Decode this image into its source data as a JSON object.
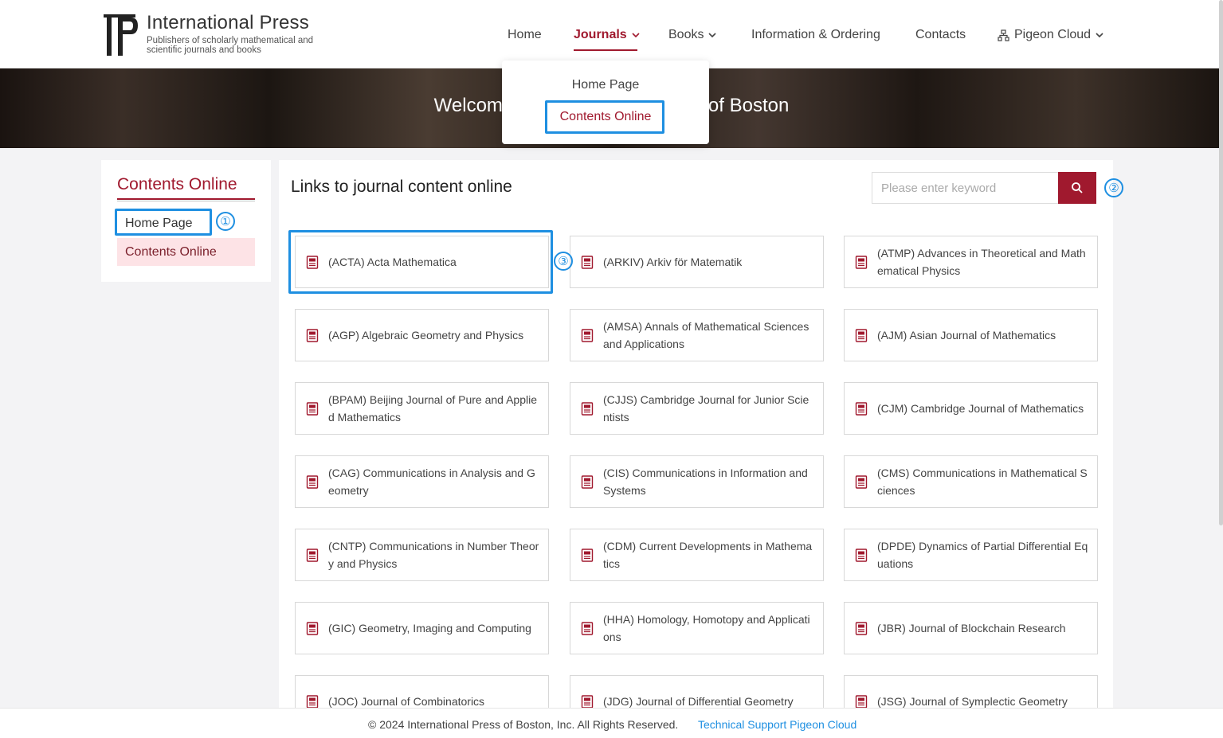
{
  "brand": {
    "title": "International Press",
    "subtitle": "Publishers of scholarly mathematical and scientific journals and books"
  },
  "nav": {
    "items": [
      {
        "label": "Home"
      },
      {
        "label": "Journals"
      },
      {
        "label": "Books"
      },
      {
        "label": "Information & Ordering"
      },
      {
        "label": "Contacts"
      },
      {
        "label": "Pigeon Cloud"
      }
    ]
  },
  "banner": {
    "text_left": "Welcom",
    "text_right": "of Boston"
  },
  "dropdown": {
    "items": [
      {
        "label": "Home Page"
      },
      {
        "label": "Contents Online"
      }
    ]
  },
  "sidebar": {
    "title": "Contents Online",
    "items": [
      {
        "label": "Home Page"
      },
      {
        "label": "Contents Online"
      }
    ]
  },
  "main": {
    "title": "Links to journal content online",
    "search_placeholder": "Please enter keyword",
    "journals": [
      "(ACTA) Acta Mathematica",
      "(ARKIV) Arkiv för Matematik",
      "(ATMP) Advances in Theoretical and Mathematical Physics",
      "(AGP) Algebraic Geometry and Physics",
      "(AMSA) Annals of Mathematical Sciences and Applications",
      "(AJM) Asian Journal of Mathematics",
      "(BPAM) Beijing Journal of Pure and Applied Mathematics",
      "(CJJS) Cambridge Journal for Junior Scientists",
      "(CJM) Cambridge Journal of Mathematics",
      "(CAG) Communications in Analysis and Geometry",
      "(CIS) Communications in Information and Systems",
      "(CMS) Communications in Mathematical Sciences",
      "(CNTP) Communications in Number Theory and Physics",
      "(CDM) Current Developments in Mathematics",
      "(DPDE) Dynamics of Partial Differential Equations",
      "(GIC) Geometry, Imaging and Computing",
      "(HHA) Homology, Homotopy and Applications",
      "(JBR) Journal of Blockchain Research",
      "(JOC) Journal of Combinatorics",
      "(JDG) Journal of Differential Geometry",
      "(JSG) Journal of Symplectic Geometry"
    ]
  },
  "annotations": [
    "①",
    "②",
    "③"
  ],
  "footer": {
    "copyright": "© 2024 International Press of Boston, Inc. All Rights Reserved.",
    "tech_support": "Technical Support Pigeon Cloud"
  },
  "colors": {
    "brand_red": "#a0192e",
    "highlight_blue": "#1e8fe1",
    "sidebar_active_bg": "#fde3e6"
  },
  "icons": [
    "chevron-down-icon",
    "network-icon",
    "search-icon",
    "document-icon"
  ]
}
